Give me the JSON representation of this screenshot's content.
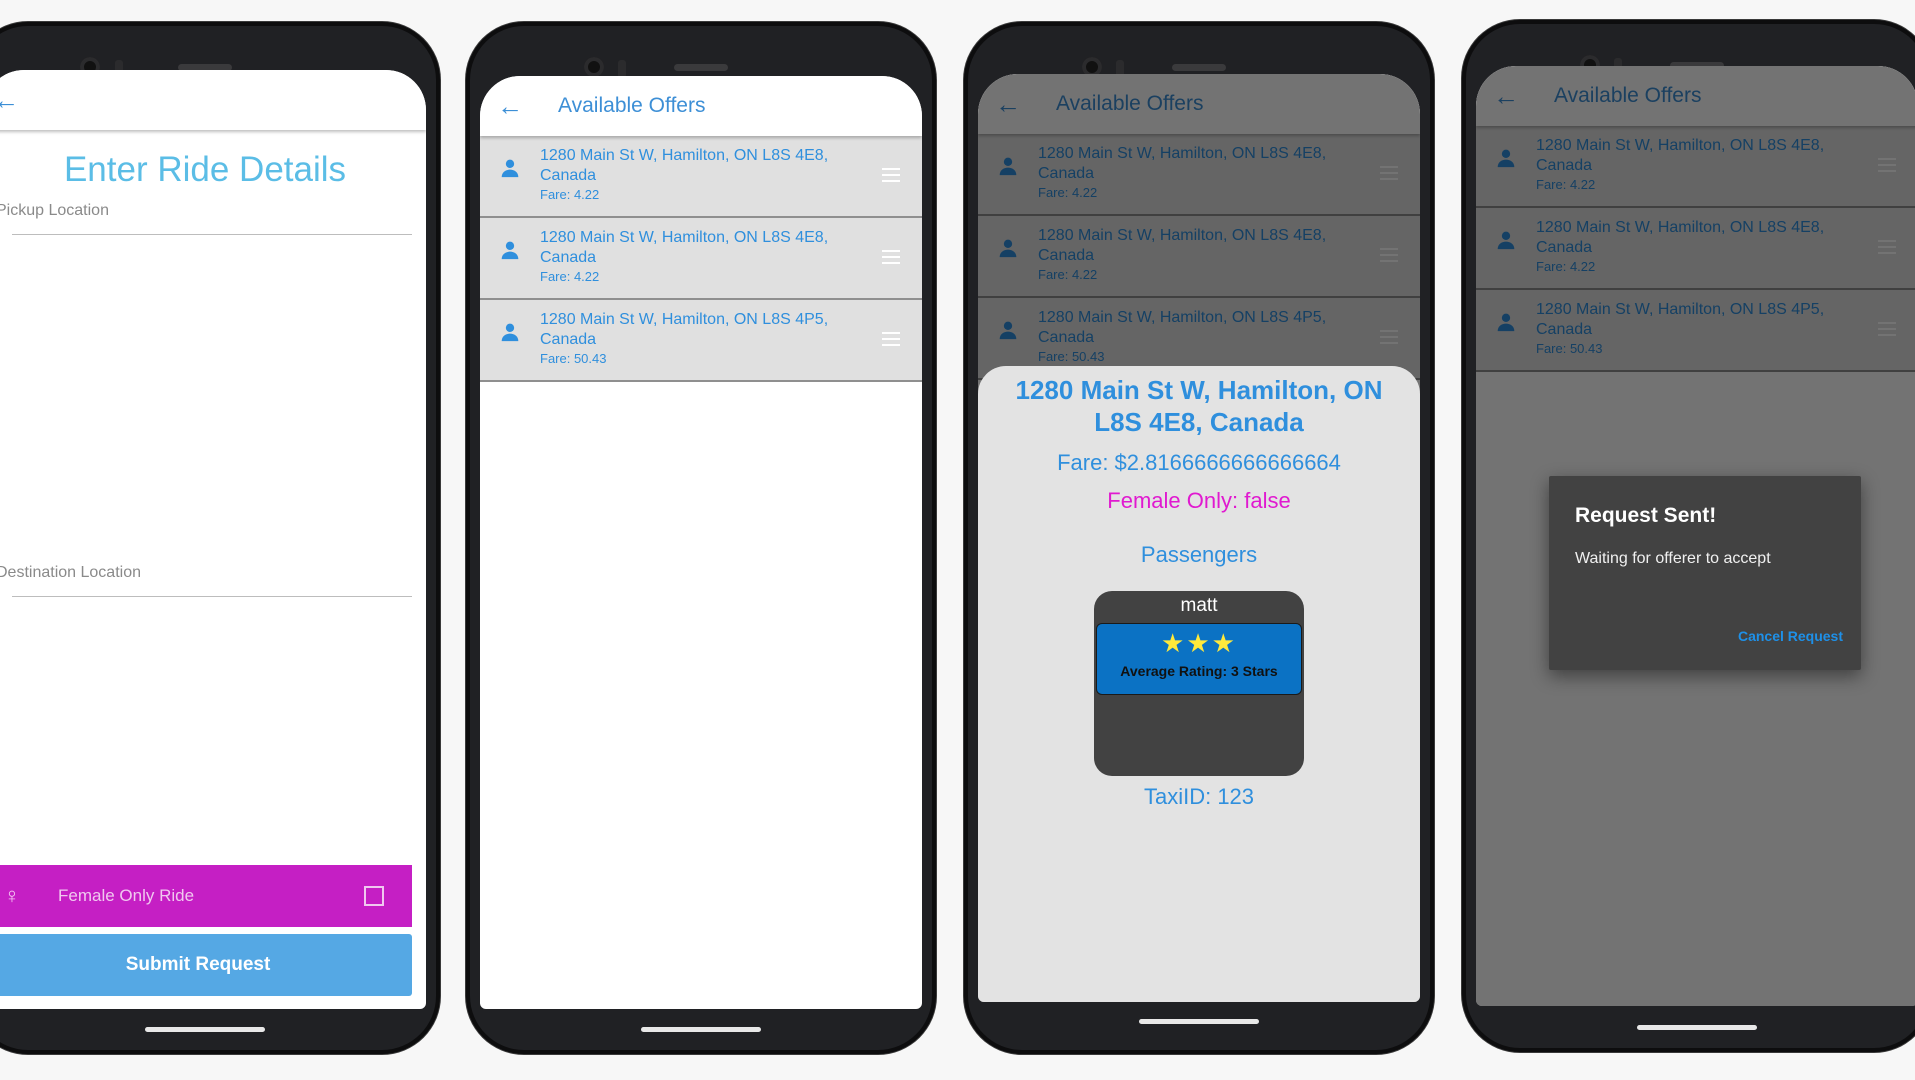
{
  "screen1": {
    "title": "Enter Ride Details",
    "pickup_label": "Pickup Location",
    "destination_label": "Destination Location",
    "female_toggle_label": "Female Only Ride",
    "submit_label": "Submit Request"
  },
  "offers_screen": {
    "title": "Available Offers",
    "offers": [
      {
        "address": "1280 Main St W, Hamilton, ON L8S 4E8, Canada",
        "fare": "Fare: 4.22"
      },
      {
        "address": "1280 Main St W, Hamilton, ON L8S 4E8, Canada",
        "fare": "Fare: 4.22"
      },
      {
        "address": "1280 Main St W, Hamilton, ON L8S 4P5, Canada",
        "fare": "Fare: 50.43"
      }
    ]
  },
  "detail": {
    "address": "1280 Main St W, Hamilton, ON L8S 4E8, Canada",
    "fare": "Fare: $2.8166666666666664",
    "female_only": "Female Only: false",
    "passengers_heading": "Passengers",
    "passenger_name": "matt",
    "stars": "★★★",
    "rating_text": "Average Rating: 3 Stars",
    "taxi_id": "TaxiID: 123"
  },
  "dialog": {
    "title": "Request Sent!",
    "message": "Waiting for offerer to accept",
    "cancel_label": "Cancel Request"
  },
  "colors": {
    "accent_blue": "#3d8fd6",
    "title_cyan": "#5bbde6",
    "female_magenta": "#c51fc4",
    "submit_blue": "#55a8e4",
    "female_text": "#e01ad0",
    "rating_blue": "#0b72c4",
    "star_yellow": "#ffe93b"
  },
  "icons": [
    "back-arrow-icon",
    "person-icon",
    "drag-handle-icon",
    "female-icon",
    "checkbox-icon",
    "star-icon"
  ]
}
